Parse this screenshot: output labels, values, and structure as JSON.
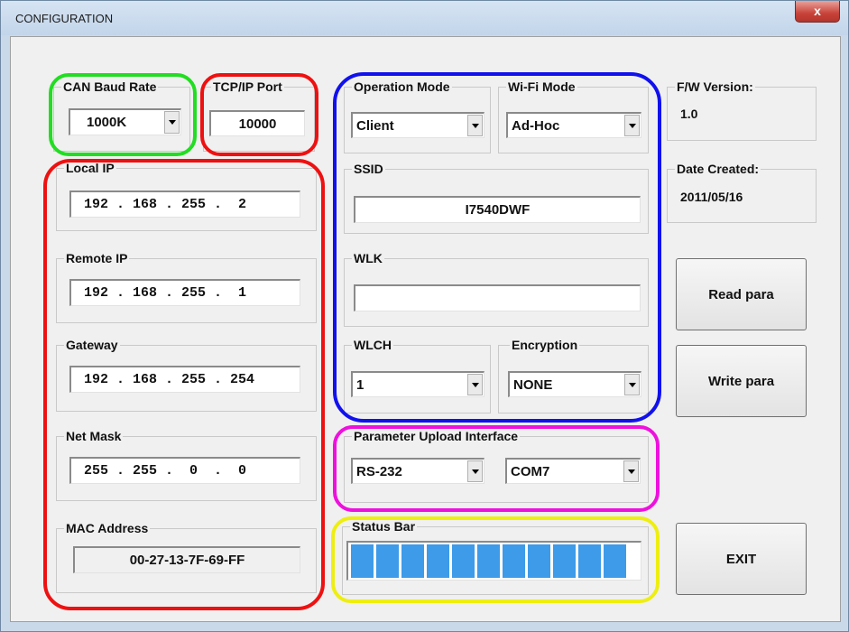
{
  "window": {
    "title": "CONFIGURATION",
    "close_glyph": "x"
  },
  "can": {
    "label": "CAN Baud Rate",
    "value": "1000K"
  },
  "tcp": {
    "label": "TCP/IP Port",
    "value": "10000"
  },
  "local_ip": {
    "label": "Local IP",
    "value": "192 . 168 . 255 .  2"
  },
  "remote_ip": {
    "label": "Remote IP",
    "value": "192 . 168 . 255 .  1"
  },
  "gateway": {
    "label": "Gateway",
    "value": "192 . 168 . 255 . 254"
  },
  "netmask": {
    "label": "Net Mask",
    "value": "255 . 255 .  0  .  0"
  },
  "mac": {
    "label": "MAC Address",
    "value": "00-27-13-7F-69-FF"
  },
  "op_mode": {
    "label": "Operation Mode",
    "value": "Client"
  },
  "wifi_mode": {
    "label": "Wi-Fi Mode",
    "value": "Ad-Hoc"
  },
  "ssid": {
    "label": "SSID",
    "value": "I7540DWF"
  },
  "wlk": {
    "label": "WLK",
    "value": ""
  },
  "wlch": {
    "label": "WLCH",
    "value": "1"
  },
  "encryption": {
    "label": "Encryption",
    "value": "NONE"
  },
  "upload": {
    "label": "Parameter Upload Interface",
    "interface": "RS-232",
    "port": "COM7"
  },
  "status": {
    "label": "Status Bar",
    "progress": 1.0,
    "segments": 11,
    "fill_color": "#3d9be9"
  },
  "fw": {
    "label": "F/W Version:",
    "value": "1.0"
  },
  "date": {
    "label": "Date Created:",
    "value": "2011/05/16"
  },
  "buttons": {
    "read": "Read para",
    "write": "Write para",
    "exit": "EXIT"
  },
  "highlights": {
    "green": "#22dd22",
    "red": "#ee1111",
    "blue": "#1111ee",
    "magenta": "#ee11dd",
    "yellow": "#eeee11"
  }
}
